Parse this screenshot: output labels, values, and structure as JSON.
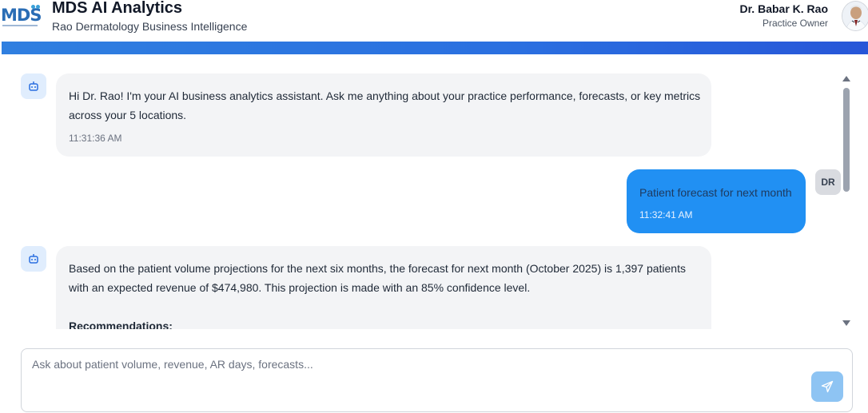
{
  "header": {
    "logo_text": "MDS",
    "title": "MDS AI Analytics",
    "subtitle": "Rao Dermatology Business Intelligence",
    "user_name": "Dr. Babar K. Rao",
    "user_role": "Practice Owner"
  },
  "messages": [
    {
      "role": "assistant",
      "icon": "bot-icon",
      "text": "Hi Dr. Rao! I'm your AI business analytics assistant. Ask me anything about your practice performance, forecasts, or key metrics across your 5 locations.",
      "time": "11:31:36 AM"
    },
    {
      "role": "user",
      "badge": "DR",
      "text": "Patient forecast for next month",
      "time": "11:32:41 AM"
    },
    {
      "role": "assistant",
      "icon": "bot-icon",
      "text": "Based on the patient volume projections for the next six months, the forecast for next month (October 2025) is 1,397 patients with an expected revenue of $474,980. This projection is made with an 85% confidence level.",
      "heading": "Recommendations:"
    }
  ],
  "input": {
    "placeholder": "Ask about patient volume, revenue, AR days, forecasts...",
    "value": ""
  },
  "colors": {
    "accent": "#2190f3",
    "send_button": "#8ec4f3",
    "bot_bubble": "#f3f4f6",
    "bot_icon_bg": "#e0edfd"
  }
}
